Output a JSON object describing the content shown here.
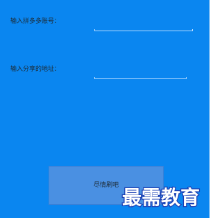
{
  "form": {
    "account_label": "输入拼多多账号：",
    "share_address_label": "输入分享的地址：",
    "account_value": "",
    "share_address_value": ""
  },
  "actions": {
    "primary_button_label": "尽情刷吧"
  },
  "branding": {
    "watermark_text": "最需教育"
  },
  "colors": {
    "background": "#0a86f0",
    "button": "#4a90e2",
    "label_text": "#1d2a33",
    "input_underline": "#b7dcff",
    "watermark_fill": "#ffffff",
    "watermark_stroke": "#1b3fb3"
  }
}
